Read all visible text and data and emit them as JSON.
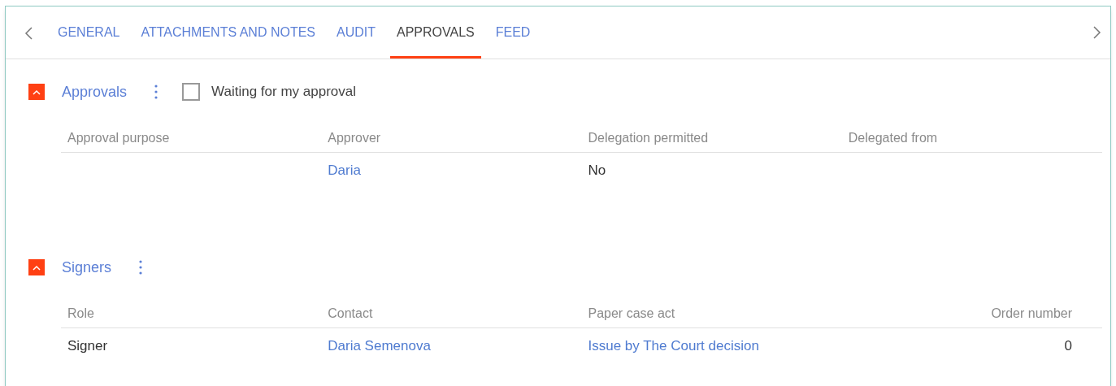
{
  "tabs": [
    {
      "label": "GENERAL",
      "selected": false
    },
    {
      "label": "ATTACHMENTS AND NOTES",
      "selected": false
    },
    {
      "label": "AUDIT",
      "selected": false
    },
    {
      "label": "APPROVALS",
      "selected": true
    },
    {
      "label": "FEED",
      "selected": false
    }
  ],
  "sections": [
    {
      "title": "Approvals",
      "expanded": true,
      "filter": {
        "label": "Waiting for my approval",
        "checked": false
      },
      "table": {
        "columns": [
          {
            "label": "Approval purpose",
            "kind": "text"
          },
          {
            "label": "Approver",
            "kind": "text"
          },
          {
            "label": "Delegation permitted",
            "kind": "text"
          },
          {
            "label": "Delegated from",
            "kind": "text"
          }
        ],
        "rows": [
          [
            null,
            {
              "kind": "link",
              "text": "Daria"
            },
            {
              "kind": "text",
              "text": "No"
            },
            null
          ]
        ]
      }
    },
    {
      "title": "Signers",
      "expanded": true,
      "table": {
        "columns": [
          {
            "label": "Role",
            "kind": "text"
          },
          {
            "label": "Contact",
            "kind": "text"
          },
          {
            "label": "Paper case act",
            "kind": "text"
          },
          {
            "label": "Order number",
            "kind": "number"
          }
        ],
        "rows": [
          [
            {
              "kind": "text",
              "text": "Signer"
            },
            {
              "kind": "link",
              "text": "Daria Semenova"
            },
            {
              "kind": "link",
              "text": "Issue by The Court decision"
            },
            {
              "kind": "text",
              "text": "0"
            }
          ]
        ]
      }
    }
  ]
}
